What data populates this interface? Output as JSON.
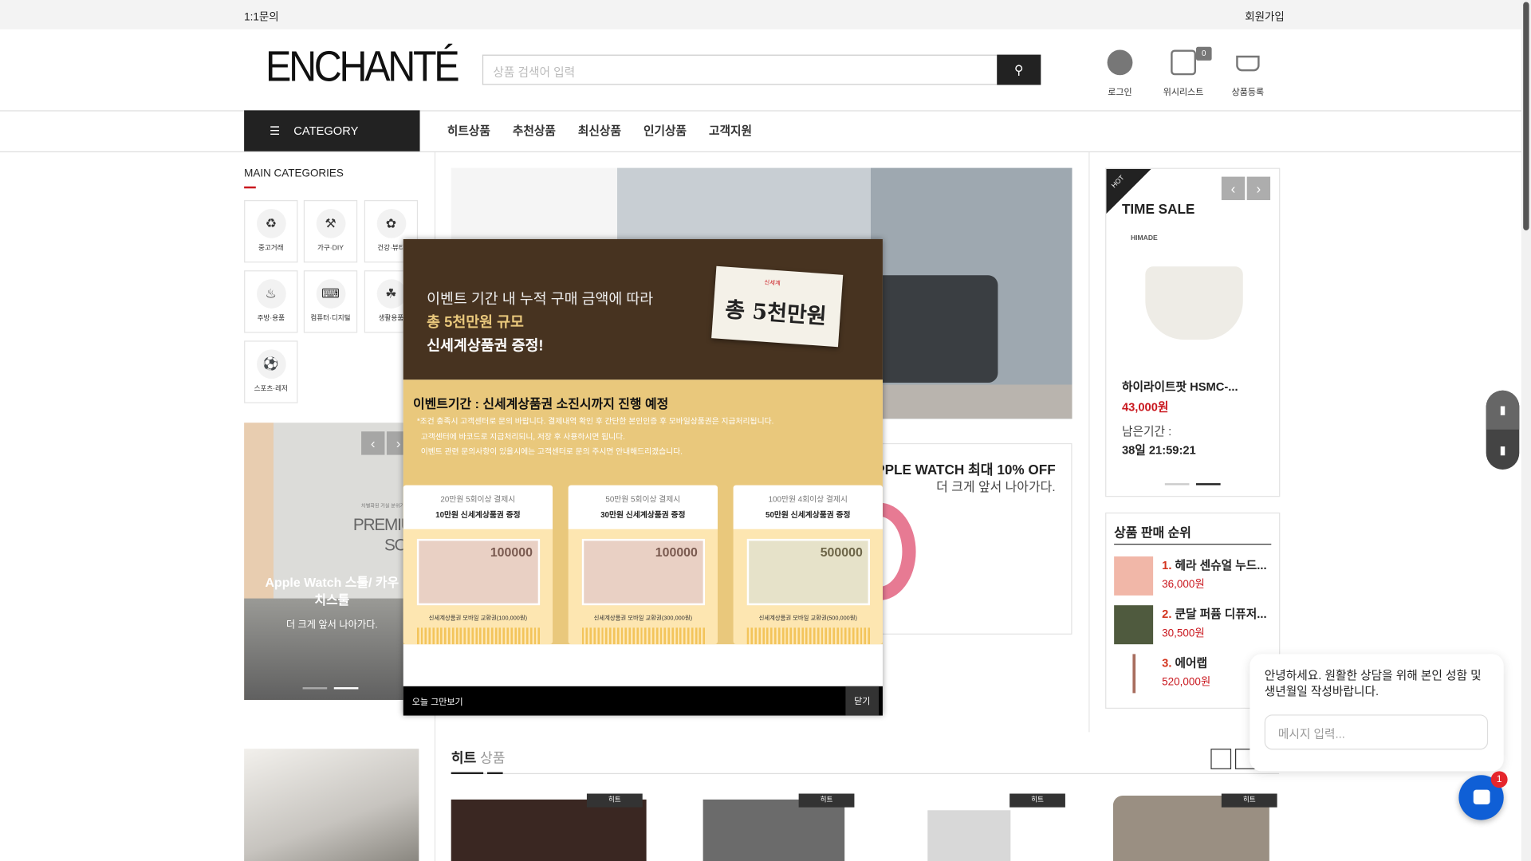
{
  "topbar": {
    "inquiry": "1:1문의",
    "signup": "회원가입"
  },
  "header": {
    "logo": "ENCHANTÉ",
    "search_placeholder": "상품 검색어 입력",
    "login": "로그인",
    "wishlist": "위시리스트",
    "wishlist_count": "0",
    "register": "상품등록"
  },
  "nav": {
    "category": "CATEGORY",
    "items": [
      "히트상품",
      "추천상품",
      "최신상품",
      "인기상품",
      "고객지원"
    ]
  },
  "sidebar": {
    "title": "MAIN CATEGORIES",
    "categories": [
      "중고거래",
      "가구·DIY",
      "건강·뷰티",
      "주방·용품",
      "컴퓨터·디지털",
      "생활용품",
      "스포츠·레저"
    ],
    "banner": {
      "title": "Apple Watch 스툴/ 카우치스툴",
      "subtitle": "더 크게 앞서 나아가다.",
      "image_text1": "차별화된 거실 분위기",
      "image_text2": "PREMIUM SOFA"
    }
  },
  "main": {
    "banner2": {
      "title": "APPLE WATCH 최대 10% OFF",
      "subtitle": "더 크게 앞서 나아가다."
    },
    "hit": {
      "title_bold": "히트",
      "title_light": "상품",
      "badge": "히트"
    }
  },
  "timesale": {
    "tag": "HOT",
    "title": "TIME SALE",
    "brand": "HIMADE",
    "product": "하이라이트팟 HSMC-...",
    "price": "43,000원",
    "remain_label": "남은기간 :",
    "remain": "38일 21:59:21"
  },
  "ranking": {
    "title": "상품 판매 순위",
    "items": [
      {
        "rank": "1.",
        "name": "헤라 센슈얼 누드...",
        "price": "36,000원"
      },
      {
        "rank": "2.",
        "name": "쿤달 퍼퓸 디퓨저...",
        "price": "30,500원"
      },
      {
        "rank": "3.",
        "name": "에어랩",
        "price": "520,000원"
      }
    ]
  },
  "popup": {
    "line1": "이벤트 기간 내 누적 구매 금액에 따라",
    "line2": "총 5천만원 규모",
    "line3": "신세계상품권 증정!",
    "card": "총 5천만원",
    "card_brand": "신세계",
    "period": "이벤트기간 : 신세계상품권 소진시까지 진행 예정",
    "notes": [
      "*조건 충족시 고객센터로 문의 바랍니다. 결제내역 확인 후 간단한 본인인증 후 모바일상품권은 지급처리됩니다.",
      "고객센터에 바코드로 지급처리되니, 저장 후 사용하시면 됩니다.",
      "이벤트 관련 문의사항이 있을시에는 고객센터로 문의 주시면 안내해드리겠습니다."
    ],
    "vouchers": [
      {
        "cond": "20만원 5회이상 결제시",
        "gift": "10만원 신세계상품권 증정",
        "amount": "100000",
        "caption": "신세계상품권 모바일 교환권(100,000원)"
      },
      {
        "cond": "50만원 5회이상 결제시",
        "gift": "30만원 신세계상품권 증정",
        "amount": "100000",
        "caption": "신세계상품권 모바일 교환권(300,000원)"
      },
      {
        "cond": "100만원 4회이상 결제시",
        "gift": "50만원 신세계상품권 증정",
        "amount": "500000",
        "caption": "신세계상품권 모바일 교환권(500,000원)"
      }
    ],
    "dont_show": "오늘 그만보기",
    "close": "닫기"
  },
  "chat": {
    "message": "안녕하세요. 원활한 상담을 위해 본인 성함 및 생년월일 작성바랍니다.",
    "placeholder": "메시지 입력...",
    "unread": "1"
  },
  "colors": {
    "accent": "#c9171e",
    "dark": "#222222",
    "popup_brown": "#473320",
    "popup_gold": "#e9c87c"
  }
}
